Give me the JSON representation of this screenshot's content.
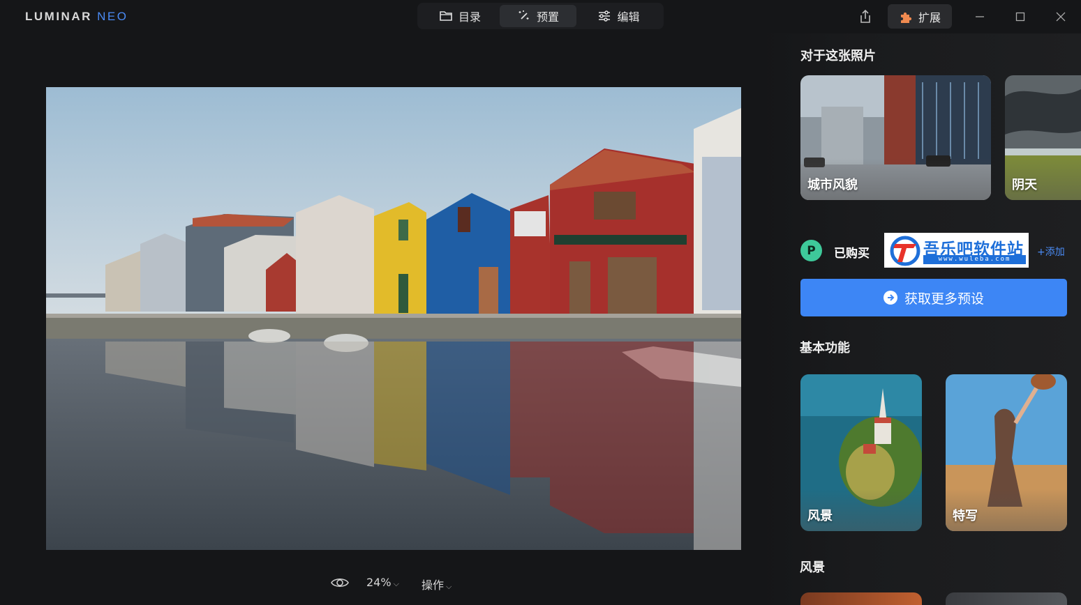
{
  "app": {
    "logo_main": "LUMINAR",
    "logo_accent": "NEO"
  },
  "mode_tabs": [
    {
      "label": "目录",
      "icon": "folder-icon"
    },
    {
      "label": "预置",
      "icon": "magic-wand-icon",
      "active": true
    },
    {
      "label": "编辑",
      "icon": "sliders-icon"
    }
  ],
  "header": {
    "extensions_label": "扩展",
    "share_icon": "share-icon"
  },
  "viewer": {
    "zoom": "24%",
    "actions_label": "操作"
  },
  "panel": {
    "about_title": "对于这张照片",
    "about_presets": [
      {
        "label": "城市风貌"
      },
      {
        "label": "阴天"
      }
    ],
    "purchased_label": "已购买",
    "add_label": "+添加",
    "watermark_text": "吾乐吧软件站",
    "watermark_url": "www.wuleba.com",
    "get_more_label": "获取更多预设",
    "basic_title": "基本功能",
    "basic_presets": [
      {
        "label": "风景"
      },
      {
        "label": "特写"
      }
    ],
    "landscape_title": "风景"
  },
  "colors": {
    "accent": "#3d86f5",
    "purchased": "#3ec99a",
    "background": "#151618"
  }
}
